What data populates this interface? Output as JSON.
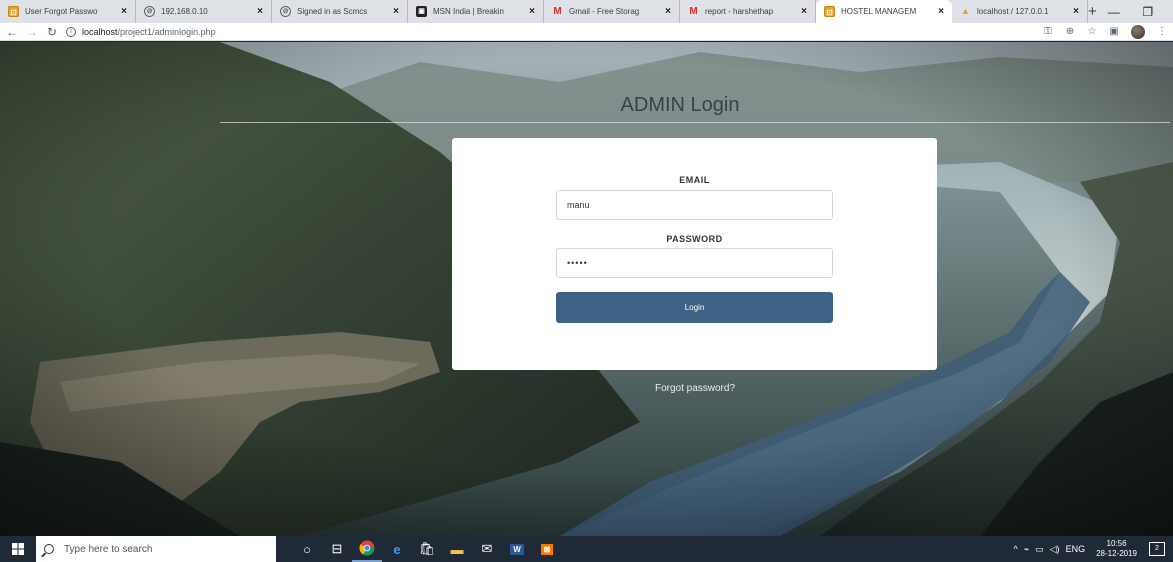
{
  "browser": {
    "tabs": [
      {
        "title": "User Forgot Passwo",
        "favicon": "orange-app-icon"
      },
      {
        "title": "192.168.0.10",
        "favicon": "globe-icon"
      },
      {
        "title": "Signed in as Scmcs",
        "favicon": "globe-icon"
      },
      {
        "title": "MSN India | Breakin",
        "favicon": "msn-icon"
      },
      {
        "title": "Gmail - Free Storag",
        "favicon": "gmail-icon"
      },
      {
        "title": "report - harshethap",
        "favicon": "gmail-icon"
      },
      {
        "title": "HOSTEL MANAGEM",
        "favicon": "orange-app-icon",
        "active": true
      },
      {
        "title": "localhost / 127.0.0.1",
        "favicon": "phpmyadmin-icon"
      }
    ],
    "new_tab": "+",
    "window_controls": {
      "minimize": "—",
      "maximize": "❐",
      "close": "✕"
    },
    "url_host": "localhost",
    "url_path": "/project1/adminlogin.php"
  },
  "page": {
    "heading": "ADMIN Login",
    "email_label": "EMAIL",
    "email_value": "manu",
    "password_label": "PASSWORD",
    "password_value": "•••••",
    "login_button": "Login",
    "forgot_link": "Forgot password?"
  },
  "taskbar": {
    "search_placeholder": "Type here to search",
    "tray_lang": "ENG",
    "time": "10:56",
    "date": "28-12-2019",
    "notification_count": "2"
  },
  "colors": {
    "button_bg": "#3d6285",
    "heading": "#3a4148",
    "taskbar": "#1f2a36"
  }
}
